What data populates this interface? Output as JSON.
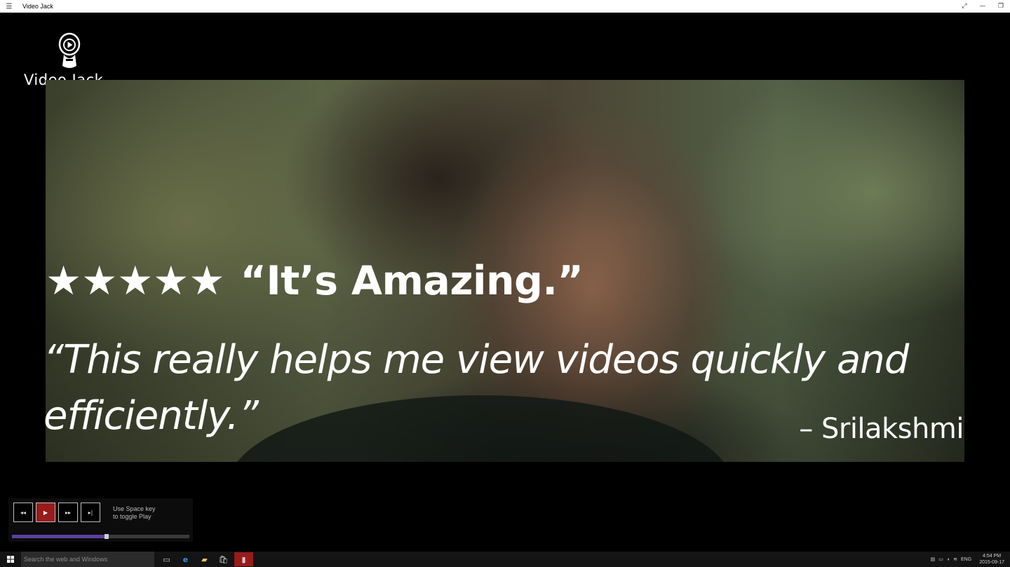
{
  "window": {
    "title": "Video Jack",
    "menu_icon": "hamburger-icon",
    "controls": [
      "fullscreen-icon",
      "minimize-icon",
      "restore-icon"
    ]
  },
  "logo": {
    "text": "Video Jack",
    "icon": "play-mascot-icon"
  },
  "review": {
    "stars": "★★★★★",
    "rating": 5,
    "headline": "“It’s Amazing.”",
    "quote": "“This really helps me view videos quickly and efficiently.”",
    "author": "– Srilakshmi"
  },
  "player": {
    "buttons": [
      {
        "name": "rewind",
        "icon": "rewind-icon",
        "glyph": "◂◂"
      },
      {
        "name": "play",
        "icon": "play-icon",
        "glyph": "▶"
      },
      {
        "name": "fast-forward",
        "icon": "fast-forward-icon",
        "glyph": "▸▸"
      },
      {
        "name": "next",
        "icon": "skip-next-icon",
        "glyph": "▸|"
      }
    ],
    "hint_line1": "Use Space key",
    "hint_line2": "to toggle Play",
    "progress": 0.52,
    "colors": {
      "play_button": "#9a1b1b",
      "progress_fill": "#5b3fa0"
    }
  },
  "taskbar": {
    "search_placeholder": "Search the web and Windows",
    "apps": [
      "task-view-icon",
      "edge-icon",
      "file-explorer-icon",
      "store-icon",
      "video-jack-icon"
    ],
    "language": "ENG",
    "time": "4:54 PM",
    "date": "2015-09-17"
  }
}
